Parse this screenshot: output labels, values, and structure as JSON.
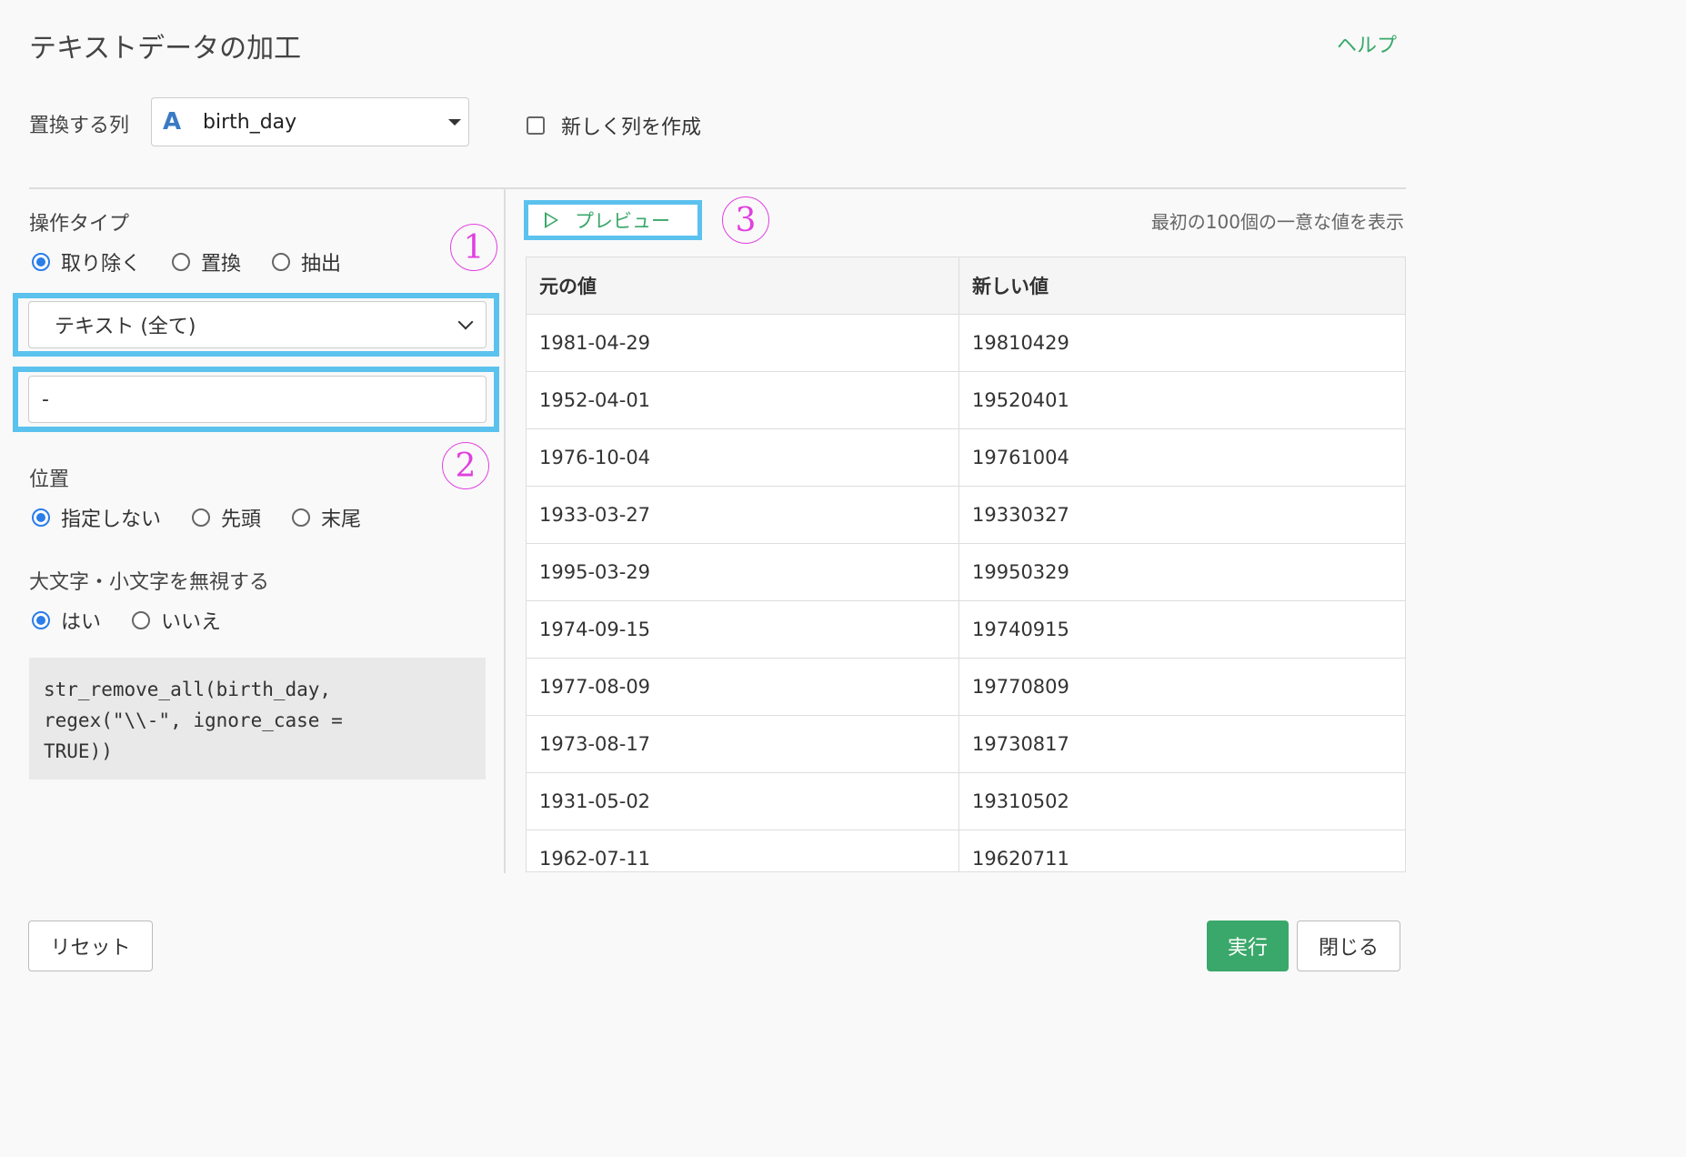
{
  "header": {
    "title": "テキストデータの加工",
    "help_label": "ヘルプ"
  },
  "column": {
    "label": "置換する列",
    "type_icon": "A",
    "value": "birth_day",
    "new_column_label": "新しく列を作成",
    "new_column_checked": false
  },
  "operation": {
    "label": "操作タイプ",
    "options": [
      {
        "label": "取り除く",
        "selected": true
      },
      {
        "label": "置換",
        "selected": false
      },
      {
        "label": "抽出",
        "selected": false
      }
    ],
    "target_select_value": "テキスト (全て)",
    "pattern_value": "-"
  },
  "position": {
    "label": "位置",
    "options": [
      {
        "label": "指定しない",
        "selected": true
      },
      {
        "label": "先頭",
        "selected": false
      },
      {
        "label": "末尾",
        "selected": false
      }
    ]
  },
  "ignore_case": {
    "label": "大文字・小文字を無視する",
    "options": [
      {
        "label": "はい",
        "selected": true
      },
      {
        "label": "いいえ",
        "selected": false
      }
    ]
  },
  "code": {
    "line1": "str_remove_all(birth_day,",
    "line2": "regex(\"\\\\-\", ignore_case =",
    "line3": "TRUE))"
  },
  "annotations": {
    "a1": "1",
    "a2": "2",
    "a3": "3"
  },
  "preview": {
    "button_label": "プレビュー",
    "note": "最初の100個の一意な値を表示",
    "columns": [
      "元の値",
      "新しい値"
    ],
    "rows": [
      [
        "1981-04-29",
        "19810429"
      ],
      [
        "1952-04-01",
        "19520401"
      ],
      [
        "1976-10-04",
        "19761004"
      ],
      [
        "1933-03-27",
        "19330327"
      ],
      [
        "1995-03-29",
        "19950329"
      ],
      [
        "1974-09-15",
        "19740915"
      ],
      [
        "1977-08-09",
        "19770809"
      ],
      [
        "1973-08-17",
        "19730817"
      ],
      [
        "1931-05-02",
        "19310502"
      ],
      [
        "1962-07-11",
        "19620711"
      ]
    ]
  },
  "footer": {
    "reset_label": "リセット",
    "run_label": "実行",
    "close_label": "閉じる"
  },
  "colors": {
    "accent_green": "#3aa86a",
    "radio_blue": "#2b7de9",
    "highlight_blue": "#5bc2ee",
    "annotation_magenta": "#e040e0"
  }
}
